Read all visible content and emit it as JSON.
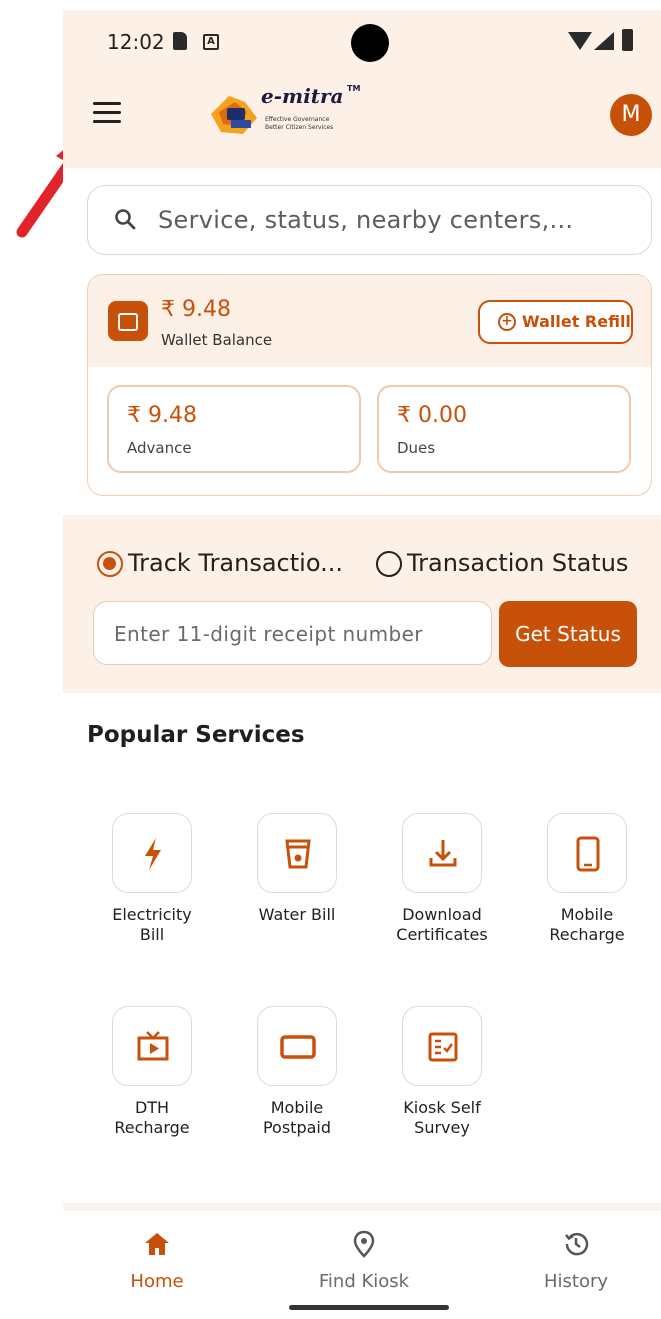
{
  "status_bar": {
    "time": "12:02",
    "a_icon_text": "A"
  },
  "header": {
    "menu_icon": "hamburger-menu-icon",
    "logo": {
      "title": "e-mitra",
      "tm": "TM",
      "tagline_1": "Effective Governance",
      "tagline_2": "Better Citizen Services"
    },
    "avatar_initial": "M"
  },
  "search": {
    "placeholder": "Service, status, nearby centers,..."
  },
  "wallet": {
    "balance": "₹ 9.48",
    "balance_label": "Wallet Balance",
    "refill_label": "Wallet Refill",
    "advance_amount": "₹ 9.48",
    "advance_label": "Advance",
    "dues_amount": "₹ 0.00",
    "dues_label": "Dues"
  },
  "track": {
    "option_1": "Track Transactio...",
    "option_2": "Transaction Status",
    "selected": "option_1",
    "receipt_placeholder": "Enter 11-digit receipt number",
    "get_status_label": "Get Status"
  },
  "popular_services": {
    "title": "Popular Services",
    "items": [
      {
        "label_1": "Electricity",
        "label_2": "Bill",
        "icon": "lightning-icon"
      },
      {
        "label_1": "Water Bill",
        "label_2": "",
        "icon": "water-glass-icon"
      },
      {
        "label_1": "Download",
        "label_2": "Certificates",
        "icon": "download-icon"
      },
      {
        "label_1": "Mobile",
        "label_2": "Recharge",
        "icon": "smartphone-icon"
      },
      {
        "label_1": "DTH",
        "label_2": "Recharge",
        "icon": "tv-icon"
      },
      {
        "label_1": "Mobile",
        "label_2": "Postpaid",
        "icon": "device-icon"
      },
      {
        "label_1": "Kiosk Self",
        "label_2": "Survey",
        "icon": "survey-checklist-icon"
      }
    ]
  },
  "bottom_nav": {
    "items": [
      {
        "label": "Home",
        "icon": "home-icon",
        "active": true
      },
      {
        "label": "Find Kiosk",
        "icon": "location-pin-icon",
        "active": false
      },
      {
        "label": "History",
        "icon": "history-icon",
        "active": false
      }
    ]
  },
  "colors": {
    "accent": "#c8510a",
    "peach": "#fdf0e6",
    "pointer_arrow": "#e0242a"
  }
}
